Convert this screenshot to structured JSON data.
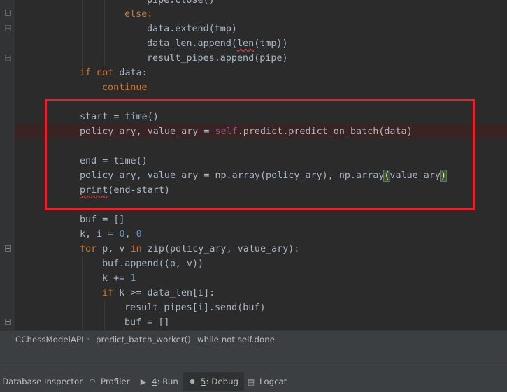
{
  "code": {
    "l1_text": "pipe.close()",
    "l2_kw": "else",
    "l2_colon": ":",
    "l3": "data.extend(tmp)",
    "l4_a": "data_len.append(",
    "l4_len": "len",
    "l4_b": "(tmp))",
    "l5": "result_pipes.append(pipe)",
    "l6_kw_if": "if",
    "l6_kw_not": "not",
    "l6_rest": " data:",
    "l7_kw": "continue",
    "l9": "start = time()",
    "l10_a": "policy_ary, value_ary = ",
    "l10_self": "self",
    "l10_b": ".predict.predict_on_batch(data)",
    "l12": "end = time()",
    "l13_a": "policy_ary, value_ary = np.array(policy_ary), np.array",
    "l13_open": "(",
    "l13_mid": "value_ary",
    "l13_close": ")",
    "l14_print": "print",
    "l14_rest": "(end-start)",
    "l16": "buf = []",
    "l17_a": "k, i = ",
    "l17_n1": "0",
    "l17_b": ", ",
    "l17_n2": "0",
    "l18_for": "for",
    "l18_a": " p, v ",
    "l18_in": "in",
    "l18_zip": "zip",
    "l18_b": "(policy_ary, value_ary):",
    "l19": "buf.append((p, v))",
    "l20_a": "k += ",
    "l20_n": "1",
    "l21_if": "if",
    "l21_b": " k >= data_len[i]:",
    "l22": "result_pipes[i].send(buf)",
    "l23": "buf = []"
  },
  "breadcrumb": {
    "items": [
      "CChessModelAPI",
      "predict_batch_worker()",
      "while not self.done"
    ],
    "separator": "›"
  },
  "toolwindows": {
    "database": "Database Inspector",
    "profiler": "Profiler",
    "run_num": "4",
    "run_label": ": Run",
    "debug_num": "5",
    "debug_label": ": Debug",
    "logcat": "Logcat"
  },
  "colors": {
    "editor_bg": "#2b2b2b",
    "keyword": "#cc7832",
    "self": "#94558d",
    "number": "#6897bb",
    "text": "#a9b7c6",
    "highlight_box": "#e52229",
    "breakpoint_line": "#3a2323"
  },
  "icons": {
    "profiler": "gauge-icon",
    "run": "play-icon",
    "debug": "bug-icon",
    "logcat": "logcat-icon"
  }
}
